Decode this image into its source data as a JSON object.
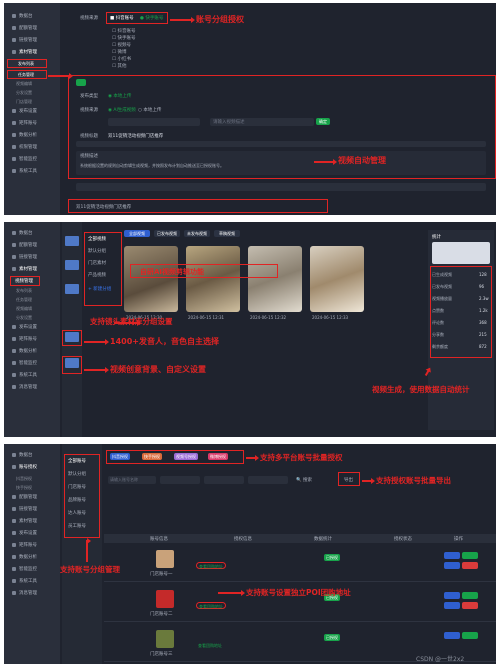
{
  "panel1": {
    "sidebar": [
      "数据台",
      "配额管理",
      "链接管理",
      "素材管理",
      "发布设置",
      "矩阵账号",
      "数据分析",
      "权限管理",
      "智能监控",
      "系统工具",
      "消息管理"
    ],
    "sidebar_sub": [
      "发布列表",
      "任务管理",
      "视频编辑",
      "分发设置",
      "门店管理"
    ],
    "callout_accounts": "账号分组授权",
    "callout_sync": "视频自动管理",
    "form_labels": [
      "视频来源",
      "发布类型",
      "视频标题",
      "视频描述"
    ],
    "checkbox_items": [
      "抖音账号",
      "快手账号",
      "视频号",
      "微博",
      "小红书",
      "其他"
    ],
    "radio_a": "本地上传",
    "radio_b": "AI生成视频",
    "title_value": "双11促销活动视频门店推荐",
    "placeholder": "请输入视频描述",
    "confirm": "确定",
    "desc_text": "系统根据设置的规则自动剪辑生成视频，并按照发布计划自动推送至已授权账号。"
  },
  "panel2": {
    "sidebar": [
      "数据台",
      "配额管理",
      "链接管理",
      "素材管理",
      "视频管理",
      "发布设置",
      "矩阵账号",
      "数据分析",
      "智能监控",
      "系统工具",
      "消息管理"
    ],
    "tabs": [
      "全部视频",
      "已发布视频",
      "未发布视频",
      "草稿视频"
    ],
    "folders": [
      "全部视频",
      "默认分组",
      "门店素材",
      "产品视频",
      "新建分组"
    ],
    "callout_top": "自研AI视频剪辑功能",
    "callout_folder": "支持镜头素材库分组设置",
    "callout_voice": "1400+发音人，音色自主选择",
    "callout_bg": "视频创意背景、自定义设置",
    "callout_stats": "视频生成，使用数据自动统计",
    "thumb_captions": [
      "2024-06-15 12:30",
      "2024-06-15 12:31",
      "2024-06-15 12:32",
      "2024-06-15 12:33"
    ],
    "stats_title": "统计",
    "stats": [
      {
        "label": "已生成视频",
        "value": "128"
      },
      {
        "label": "已发布视频",
        "value": "96"
      },
      {
        "label": "视频播放量",
        "value": "2.3w"
      },
      {
        "label": "点赞数",
        "value": "1.2k"
      },
      {
        "label": "评论数",
        "value": "368"
      },
      {
        "label": "分享数",
        "value": "215"
      },
      {
        "label": "剩余额度",
        "value": "872"
      }
    ]
  },
  "panel3": {
    "sidebar": [
      "数据台",
      "账号授权",
      "配额管理",
      "链接管理",
      "素材管理",
      "发布设置",
      "矩阵账号",
      "数据分析",
      "智能监控",
      "系统工具",
      "消息管理"
    ],
    "tabs": [
      "抖音授权",
      "快手授权",
      "视频号授权",
      "微博授权"
    ],
    "callout_platform": "支持多平台账号批量授权",
    "callout_export": "支持授权账号批量导出",
    "callout_group": "支持账号分组管理",
    "callout_poi": "支持账号设置独立POI团购地址",
    "group_list": [
      "全部账号",
      "默认分组",
      "门店账号",
      "品牌账号",
      "达人账号",
      "员工账号"
    ],
    "search_placeholder": "请输入账号名称",
    "search_btn": "搜索",
    "export_btn": "导出",
    "columns": [
      "账号信息",
      "授权信息",
      "数据统计",
      "授权状态",
      "操作"
    ],
    "rows": [
      {
        "name": "门店账号一",
        "poi": "查看团购地址",
        "status": "已授权"
      },
      {
        "name": "门店账号二",
        "poi": "查看团购地址",
        "status": "已授权"
      },
      {
        "name": "门店账号三",
        "poi": "查看团购地址",
        "status": "已授权"
      }
    ],
    "watermark": "CSDN @一世2x2"
  },
  "colors": {
    "accent": "#3a76f0",
    "callout": "#e02424",
    "bg": "#1f232e",
    "sidebar": "#2a2f3b"
  }
}
